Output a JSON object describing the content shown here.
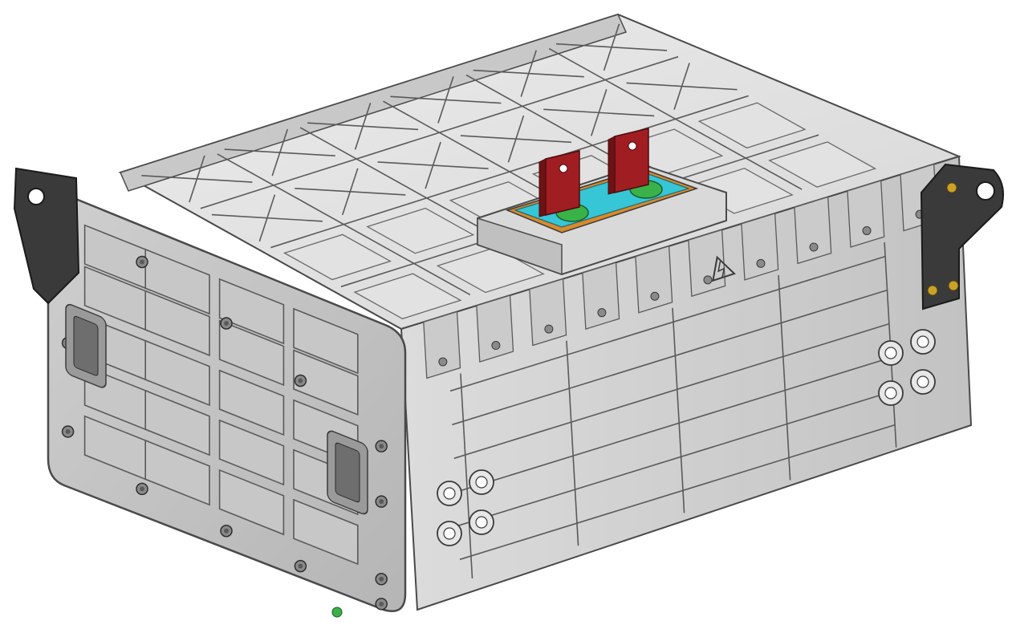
{
  "image": {
    "subject": "isometric-cad-render",
    "background": "#ffffff",
    "colors": {
      "housing_light": "#d4d4d4",
      "housing_mid": "#bdbdbd",
      "housing_dark": "#9c9c9c",
      "edge": "#4a4a4a",
      "bracket": "#3a3a3a",
      "terminal_red": "#a01e22",
      "gasket_cyan": "#36c6d6",
      "gasket_orange": "#d98a2a",
      "terminal_green": "#39b24a",
      "bolt_gold": "#c9a227"
    }
  }
}
